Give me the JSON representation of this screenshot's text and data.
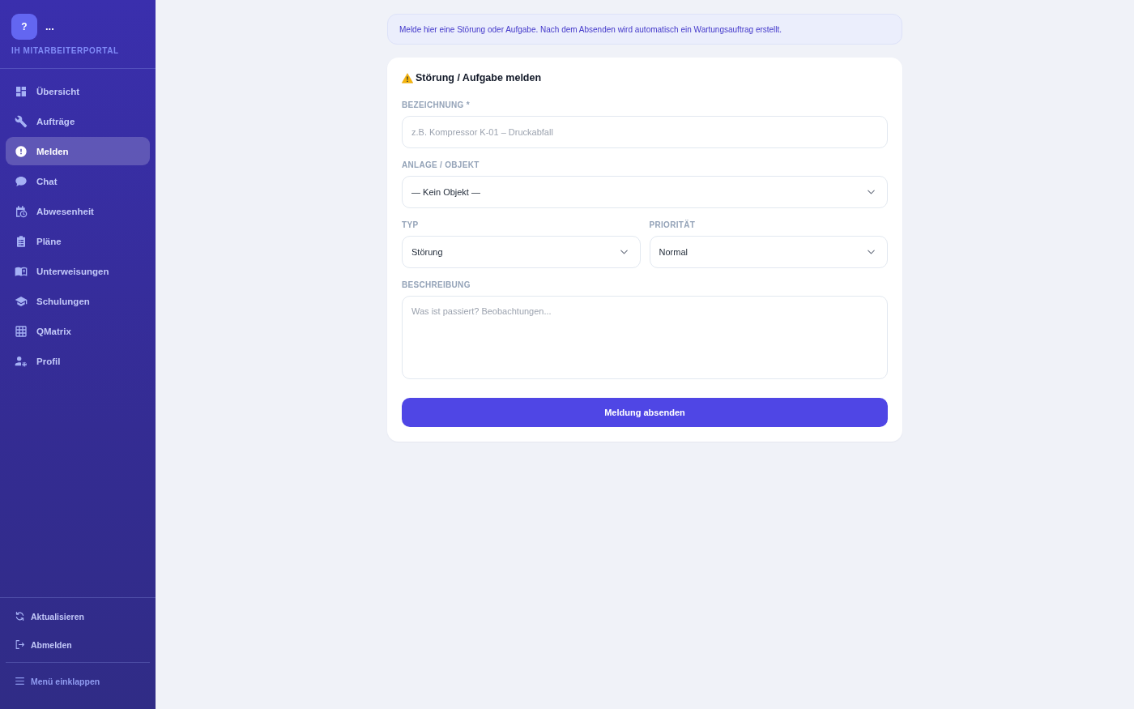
{
  "sidebar": {
    "avatar": "?",
    "user_name": "...",
    "portal_title": "IH MITARBEITERPORTAL",
    "nav_items": [
      {
        "label": "Übersicht",
        "selected": false
      },
      {
        "label": "Aufträge",
        "selected": false
      },
      {
        "label": "Melden",
        "selected": true
      },
      {
        "label": "Chat",
        "selected": false
      },
      {
        "label": "Abwesenheit",
        "selected": false
      },
      {
        "label": "Pläne",
        "selected": false
      },
      {
        "label": "Unterweisungen",
        "selected": false
      },
      {
        "label": "Schulungen",
        "selected": false
      },
      {
        "label": "QMatrix",
        "selected": false
      },
      {
        "label": "Profil",
        "selected": false
      }
    ],
    "actions": [
      {
        "label": "Aktualisieren"
      },
      {
        "label": "Abmelden"
      }
    ],
    "collapse_label": "Menü einklappen"
  },
  "info_banner": "Melde hier eine Störung oder Aufgabe. Nach dem Absenden wird automatisch ein Wartungsauftrag erstellt.",
  "form": {
    "title": "Störung / Aufgabe melden",
    "rows": [
      {
        "fields": [
          {
            "kind": "text",
            "label": "BEZEICHNUNG *",
            "placeholder": "z.B. Kompressor K-01 – Druckabfall"
          }
        ]
      },
      {
        "fields": [
          {
            "kind": "select",
            "label": "ANLAGE / OBJEKT",
            "value": "— Kein Objekt —"
          }
        ]
      },
      {
        "fields": [
          {
            "kind": "select",
            "label": "TYP",
            "value": "Störung"
          },
          {
            "kind": "select",
            "label": "PRIORITÄT",
            "value": "Normal"
          }
        ]
      },
      {
        "fields": [
          {
            "kind": "textarea",
            "label": "BESCHREIBUNG",
            "placeholder": "Was ist passiert? Beobachtungen..."
          }
        ]
      }
    ],
    "submit_label": "Meldung absenden"
  }
}
